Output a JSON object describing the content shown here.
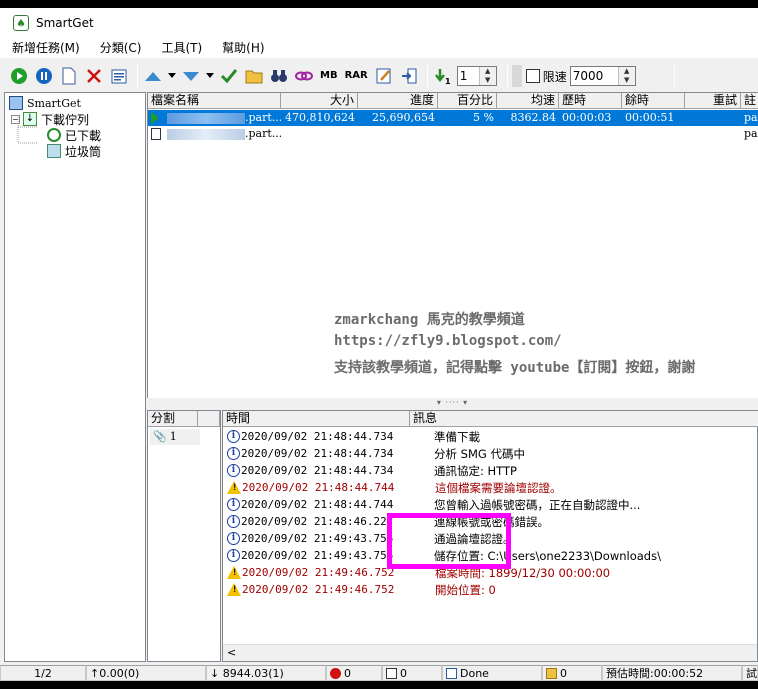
{
  "window": {
    "title": "SmartGet"
  },
  "menu": [
    "新增任務(M)",
    "分類(C)",
    "工具(T)",
    "幫助(H)"
  ],
  "toolbar": {
    "buttons": [
      {
        "name": "start-icon",
        "glyph": "▶",
        "color": "#1e9e2a"
      },
      {
        "name": "pause-icon",
        "glyph": "⏸",
        "color": "#1565c0"
      },
      {
        "name": "new-file-icon",
        "glyph": "🗋",
        "color": "#3a5a9a"
      },
      {
        "name": "delete-icon",
        "glyph": "✕",
        "color": "#d01010"
      },
      {
        "name": "properties-icon",
        "glyph": "▦",
        "color": "#2a5aa0"
      },
      {
        "name": "move-up-icon",
        "glyph": "▲",
        "color": "#3a8ad0"
      },
      {
        "name": "move-down-icon",
        "glyph": "▼",
        "color": "#3a8ad0"
      },
      {
        "name": "check-icon",
        "glyph": "✔",
        "color": "#2a8a2a"
      },
      {
        "name": "folder-icon",
        "glyph": "📂",
        "color": "#c89a20"
      },
      {
        "name": "binoculars-icon",
        "glyph": "🔭",
        "color": "#2a3a6a"
      },
      {
        "name": "link-icon",
        "glyph": "∞",
        "color": "#a020a0"
      }
    ],
    "mb_label": "MB",
    "rar_label": "RAR",
    "threads_value": "1",
    "speed_limit_label": "限速",
    "speed_limit_value": "7000"
  },
  "tree": {
    "root": "SmartGet",
    "queue": "下載佇列",
    "downloaded": "已下載",
    "trash": "垃圾筒"
  },
  "files": {
    "headers": [
      "檔案名稱",
      "大小",
      "進度",
      "百分比",
      "均速",
      "歷時",
      "餘時",
      "重試",
      "註"
    ],
    "rows": [
      {
        "suffix": ".part...",
        "size": "470,810,624",
        "progress": "25,690,654",
        "percent": "5 %",
        "speed": "8362.84",
        "elapsed": "00:00:03",
        "remaining": "00:00:51",
        "retry": "",
        "note": "pas"
      },
      {
        "suffix": ".part...",
        "size": "",
        "progress": "",
        "percent": "",
        "speed": "",
        "elapsed": "",
        "remaining": "",
        "retry": "",
        "note": "pas"
      }
    ]
  },
  "watermark": {
    "line1": "zmarkchang 馬克的教學頻道",
    "line2": "https://zfly9.blogspot.com/",
    "line3": "支持該教學頻道，記得點擊 youtube【訂閱】按鈕，謝謝"
  },
  "segments": {
    "header": "分割",
    "items": [
      "1"
    ]
  },
  "log": {
    "headers": [
      "時間",
      "訊息"
    ],
    "rows": [
      {
        "type": "info",
        "time": "2020/09/02 21:48:44.734",
        "msg": "準備下載"
      },
      {
        "type": "info",
        "time": "2020/09/02 21:48:44.734",
        "msg": "分析 SMG 代碼中"
      },
      {
        "type": "info",
        "time": "2020/09/02 21:48:44.734",
        "msg": "通訊協定: HTTP"
      },
      {
        "type": "warn",
        "time": "2020/09/02 21:48:44.744",
        "msg": "這個檔案需要論壇認證。"
      },
      {
        "type": "info",
        "time": "2020/09/02 21:48:44.744",
        "msg": "您曾輸入過帳號密碼，正在自動認證中..."
      },
      {
        "type": "info",
        "time": "2020/09/02 21:48:46.227",
        "msg": "連線帳號或密碼錯誤。"
      },
      {
        "type": "info",
        "time": "2020/09/02 21:49:43.755",
        "msg": "通過論壇認證。"
      },
      {
        "type": "info",
        "time": "2020/09/02 21:49:43.755",
        "msg": "儲存位置: C:\\Users\\one2233\\Downloads\\"
      },
      {
        "type": "warn",
        "time": "2020/09/02 21:49:46.752",
        "msg": "檔案時間: 1899/12/30 00:00:00"
      },
      {
        "type": "warn",
        "time": "2020/09/02 21:49:46.752",
        "msg": "開始位置: 0"
      }
    ]
  },
  "status": {
    "page": "1/2",
    "upload": "↑0.00(0)",
    "download": "↓ 8944.03(1)",
    "errors": "0",
    "queued": "0",
    "state": "Done",
    "folders": "0",
    "eta": "預估時間:00:00:52",
    "last": "試"
  }
}
